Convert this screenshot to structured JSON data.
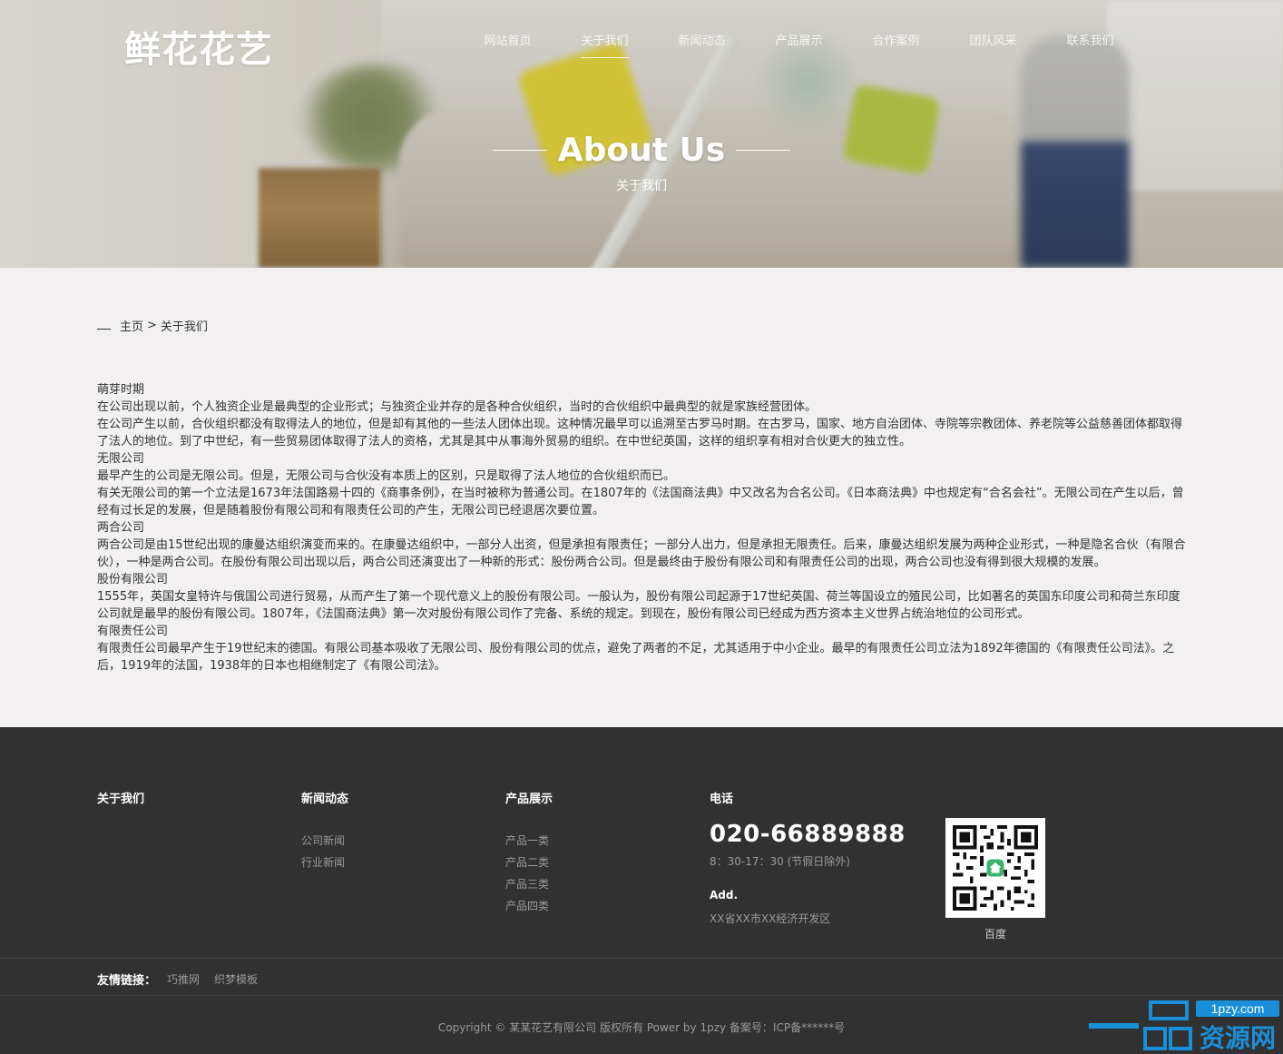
{
  "header": {
    "logo": "鲜花花艺",
    "nav": [
      {
        "label": "网站首页",
        "active": false
      },
      {
        "label": "关于我们",
        "active": true
      },
      {
        "label": "新闻动态",
        "active": false
      },
      {
        "label": "产品展示",
        "active": false
      },
      {
        "label": "合作案例",
        "active": false
      },
      {
        "label": "团队风采",
        "active": false
      },
      {
        "label": "联系我们",
        "active": false
      }
    ]
  },
  "banner": {
    "title": "About Us",
    "subtitle": "关于我们"
  },
  "breadcrumb": {
    "home": "主页",
    "separator": ">",
    "current": "关于我们"
  },
  "article": {
    "paragraphs": [
      "萌芽时期",
      "在公司出现以前，个人独资企业是最典型的企业形式；与独资企业并存的是各种合伙组织，当时的合伙组织中最典型的就是家族经营团体。",
      "在公司产生以前，合伙组织都没有取得法人的地位，但是却有其他的一些法人团体出现。这种情况最早可以追溯至古罗马时期。在古罗马，国家、地方自治团体、寺院等宗教团体、养老院等公益慈善团体都取得了法人的地位。到了中世纪，有一些贸易团体取得了法人的资格，尤其是其中从事海外贸易的组织。在中世纪英国，这样的组织享有相对合伙更大的独立性。",
      "无限公司",
      "最早产生的公司是无限公司。但是，无限公司与合伙没有本质上的区别，只是取得了法人地位的合伙组织而已。",
      "有关无限公司的第一个立法是1673年法国路易十四的《商事条例》，在当时被称为普通公司。在1807年的《法国商法典》中又改名为合名公司。《日本商法典》中也规定有“合名会社”。无限公司在产生以后，曾经有过长足的发展，但是随着股份有限公司和有限责任公司的产生，无限公司已经退居次要位置。",
      "两合公司",
      "两合公司是由15世纪出现的康曼达组织演变而来的。在康曼达组织中，一部分人出资，但是承担有限责任；一部分人出力，但是承担无限责任。后来，康曼达组织发展为两种企业形式，一种是隐名合伙（有限合伙），一种是两合公司。在股份有限公司出现以后，两合公司还演变出了一种新的形式：股份两合公司。但是最终由于股份有限公司和有限责任公司的出现，两合公司也没有得到很大规模的发展。",
      "股份有限公司",
      "1555年，英国女皇特许与俄国公司进行贸易，从而产生了第一个现代意义上的股份有限公司。一般认为，股份有限公司起源于17世纪英国、荷兰等国设立的殖民公司，比如著名的英国东印度公司和荷兰东印度公司就是最早的股份有限公司。1807年，《法国商法典》第一次对股份有限公司作了完备、系统的规定。到现在，股份有限公司已经成为西方资本主义世界占统治地位的公司形式。",
      "有限责任公司",
      "有限责任公司最早产生于19世纪末的德国。有限公司基本吸收了无限公司、股份有限公司的优点，避免了两者的不足，尤其适用于中小企业。最早的有限责任公司立法为1892年德国的《有限责任公司法》。之后，1919年的法国，1938年的日本也相继制定了《有限公司法》。"
    ]
  },
  "footer": {
    "col_about": {
      "title": "关于我们"
    },
    "col_news": {
      "title": "新闻动态",
      "items": [
        "公司新闻",
        "行业新闻"
      ]
    },
    "col_products": {
      "title": "产品展示",
      "items": [
        "产品一类",
        "产品二类",
        "产品三类",
        "产品四类"
      ]
    },
    "col_contact": {
      "title": "电话",
      "phone": "020-66889888",
      "hours": "8：30-17：30 (节假日除外)",
      "addr_label": "Add.",
      "addr": "XX省XX市XX经济开发区"
    },
    "qr_label": "百度",
    "links_label": "友情链接：",
    "links": [
      "巧推网",
      "织梦模板"
    ],
    "copyright": "Copyright © 某某花艺有限公司 版权所有 Power by 1pzy 备案号：ICP备******号"
  },
  "watermark": {
    "domain": "1pzy.com",
    "text": "资源网"
  },
  "colors": {
    "content_bg": "#f2f0f0",
    "footer_bg": "#313131",
    "watermark_blue": "#1a8fd9"
  }
}
